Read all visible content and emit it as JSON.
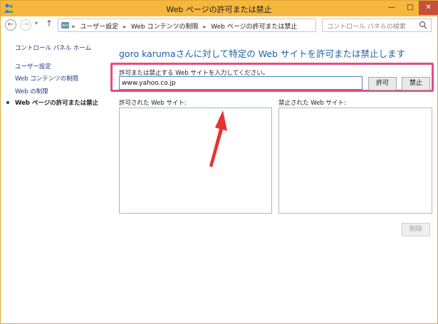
{
  "window": {
    "title": "Web ページの許可または禁止",
    "minimize_glyph": "—",
    "maximize_glyph": "□",
    "close_glyph": "✕"
  },
  "addressbar": {
    "back_glyph": "←",
    "forward_glyph": "→",
    "dropdown_glyph": "▾",
    "up_glyph": "↑",
    "crumb_prefix": "«",
    "breadcrumbs": [
      "ユーザー設定",
      "Web コンテンツの制限",
      "Web ページの許可または禁止"
    ],
    "crumb_separator": "▸",
    "refresh_glyph": "↻",
    "search_placeholder": "コントロール パネルの検索"
  },
  "leftnav": {
    "home": "コントロール パネル ホーム",
    "items": [
      {
        "label": "ユーザー設定",
        "current": false
      },
      {
        "label": "Web コンテンツの制限",
        "current": false
      },
      {
        "label": "Web の制限",
        "current": false
      },
      {
        "label": "Web ページの許可または禁止",
        "current": true
      }
    ]
  },
  "main": {
    "heading": "goro karumaさんに対して特定の Web サイトを許可または禁止します",
    "entry_label": "許可または禁止する Web サイトを入力してください。",
    "site_value": "www.yahoo.co.jp",
    "allow_button": "許可",
    "block_button": "禁止",
    "allowed_label": "許可された Web サイト:",
    "blocked_label": "禁止された Web サイト:",
    "allowed_sites": [],
    "blocked_sites": [],
    "delete_button": "削除"
  },
  "colors": {
    "titlebar": "#f6b73c",
    "close_button": "#c7503a",
    "heading": "#1f5fa8",
    "highlight_border": "#e84b7d",
    "arrow": "#e8322f"
  }
}
